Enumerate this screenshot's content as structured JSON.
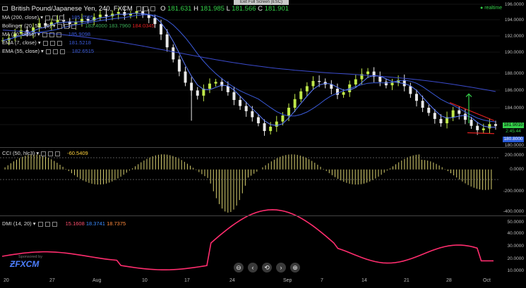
{
  "header": {
    "symbol": "British Pound/Japanese Yen, 240, FXCM",
    "o_label": "O",
    "o_val": "181.631",
    "h_label": "H",
    "h_val": "181.985",
    "l_label": "L",
    "l_val": "181.566",
    "c_label": "C",
    "c_val": "181.901",
    "exit_label": "Exit Full Screen (ESC)",
    "realtime": "realtime"
  },
  "indicators": [
    {
      "label": "MA (200, close)",
      "value": "185.7585",
      "color": "#3b5bdb"
    },
    {
      "label": "Bollinger (20, 52, 26)",
      "value": "",
      "color": "#aaaaaa"
    },
    {
      "label": "MA (20, close)",
      "value": "185.9098",
      "color": "#3b5bdb"
    },
    {
      "label": "EMA (7, close)",
      "value": "181.5218",
      "color": "#3b5bdb"
    },
    {
      "label": "EMA (55, close)",
      "value": "182.6515",
      "color": "#3b5bdb"
    }
  ],
  "overlay_vals": [
    "183.4000",
    "183.7960",
    "184.0345"
  ],
  "price_axis": [
    "196.0000",
    "194.0000",
    "192.0000",
    "190.0000",
    "188.0000",
    "186.0000",
    "184.0000",
    "182.0000",
    "180.0000"
  ],
  "price_tags": {
    "last": "181.9010",
    "time": "2:45:44",
    "low": "180.8000"
  },
  "cci": {
    "label": "CCI (50, hlc3)",
    "value": "-60.5409",
    "axis": [
      "200.0000",
      "0.0000",
      "-200.0000",
      "-400.0000"
    ]
  },
  "dmi": {
    "label": "DMI (14, 20)",
    "v1": "15.1608",
    "v2": "18.3741",
    "v3": "18.7375",
    "axis": [
      "50.0000",
      "40.0000",
      "30.0000",
      "20.0000",
      "10.0000"
    ]
  },
  "x_axis": [
    "20",
    "27",
    "Aug",
    "10",
    "17",
    "24",
    "Sep",
    "7",
    "14",
    "21",
    "28",
    "Oct"
  ],
  "sponsor": {
    "small": "Sponsored by",
    "brand": "FXCM"
  },
  "nav_buttons": [
    "⊖",
    "‹",
    "⟲",
    "›",
    "⊕"
  ],
  "colors": {
    "bull": "#bfe84a",
    "bear": "#e8e8e8",
    "ma_blue": "#3b5bdb",
    "cci": "#d8d070",
    "dmi": "#ff2d6e",
    "green": "#35d04a",
    "red": "#e02020"
  },
  "chart_data": {
    "type": "line",
    "price_close_series": [
      191.8,
      192.1,
      192.6,
      193.0,
      192.7,
      193.3,
      193.8,
      193.5,
      193.9,
      194.2,
      194.0,
      193.7,
      193.9,
      194.3,
      194.1,
      194.5,
      194.8,
      194.6,
      194.9,
      195.1,
      194.7,
      194.9,
      195.2,
      194.8,
      194.4,
      193.7,
      192.5,
      191.0,
      189.6,
      188.2,
      186.9,
      186.0,
      185.4,
      186.2,
      186.8,
      187.0,
      186.5,
      185.8,
      184.9,
      184.2,
      183.6,
      182.9,
      182.2,
      181.3,
      181.8,
      182.4,
      183.1,
      184.0,
      185.0,
      185.9,
      186.5,
      187.1,
      187.0,
      186.7,
      186.2,
      185.5,
      185.8,
      186.7,
      187.3,
      187.9,
      188.2,
      187.6,
      187.0,
      186.6,
      186.9,
      187.2,
      186.5,
      185.6,
      184.8,
      184.0,
      183.4,
      182.7,
      182.2,
      182.9,
      183.7,
      183.3,
      182.6,
      181.9,
      181.4,
      181.6,
      182.1,
      181.9
    ],
    "cci_range": [
      -400,
      200
    ],
    "dmi_range": [
      0,
      55
    ]
  }
}
